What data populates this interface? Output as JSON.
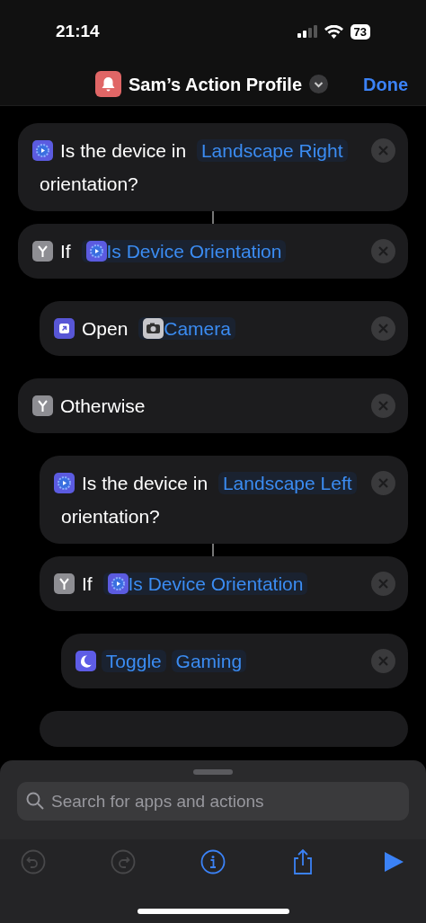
{
  "status_bar": {
    "time": "21:14",
    "battery": "73"
  },
  "nav": {
    "title": "Sam’s Action Profile",
    "done": "Done"
  },
  "actions": [
    {
      "kind": "question",
      "parts": [
        {
          "kind": "text",
          "text": "Is the device in"
        },
        {
          "kind": "token",
          "text": "Landscape Right"
        },
        {
          "kind": "text",
          "text": "orientation?"
        }
      ]
    },
    {
      "kind": "if",
      "parts": [
        {
          "kind": "text",
          "text": "If"
        },
        {
          "kind": "variable",
          "text": "Is Device Orientation"
        }
      ],
      "children": [
        {
          "kind": "open",
          "parts": [
            {
              "kind": "text",
              "text": "Open"
            },
            {
              "kind": "app",
              "text": "Camera"
            }
          ]
        }
      ]
    },
    {
      "kind": "if",
      "parts": [
        {
          "kind": "text",
          "text": "Otherwise"
        }
      ],
      "children": [
        {
          "kind": "question",
          "parts": [
            {
              "kind": "text",
              "text": "Is the device in"
            },
            {
              "kind": "token",
              "text": "Landscape Left"
            },
            {
              "kind": "text",
              "text": "orientation?"
            }
          ]
        },
        {
          "kind": "if",
          "parts": [
            {
              "kind": "text",
              "text": "If"
            },
            {
              "kind": "variable",
              "text": "Is Device Orientation"
            }
          ],
          "children": [
            {
              "kind": "focus",
              "parts": [
                {
                  "kind": "token",
                  "text": "Toggle"
                },
                {
                  "kind": "token",
                  "text": "Gaming"
                }
              ]
            }
          ]
        }
      ]
    }
  ],
  "search": {
    "placeholder": "Search for apps and actions"
  },
  "toolbar": [
    {
      "kind": "undo",
      "disabled": true
    },
    {
      "kind": "redo",
      "disabled": true
    },
    {
      "kind": "info",
      "disabled": false
    },
    {
      "kind": "share",
      "disabled": false
    },
    {
      "kind": "run",
      "disabled": false
    }
  ]
}
